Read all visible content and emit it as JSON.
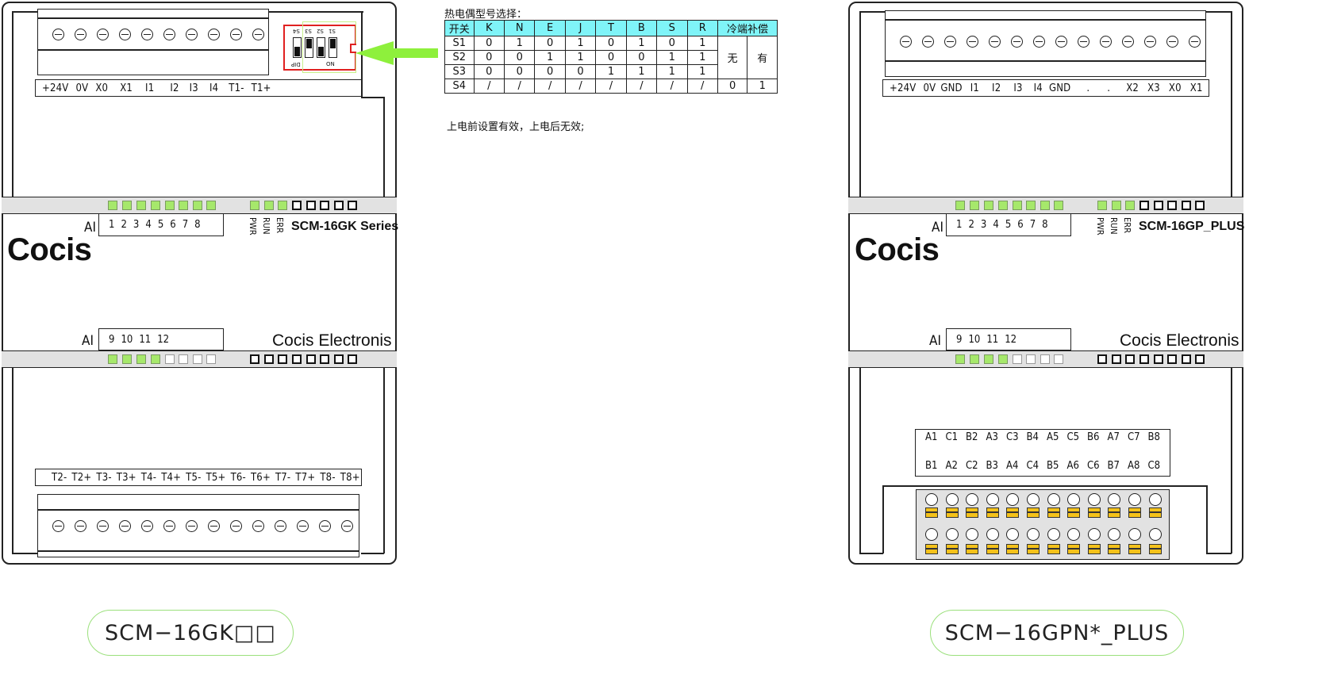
{
  "left_module": {
    "top_terminals": [
      "+24V",
      "0V",
      "X0",
      "X1",
      "I1",
      "I2",
      "I3",
      "I4",
      "T1-",
      "T1+"
    ],
    "dip_labels": [
      "S4",
      "S3",
      "S2",
      "S1"
    ],
    "dip_text_dip": "DIP",
    "dip_text_on": "ON",
    "ai_label_1": "AI",
    "ai_numbers_1": [
      "1",
      "2",
      "3",
      "4",
      "5",
      "6",
      "7",
      "8"
    ],
    "status_labels": [
      "PWR",
      "RUN",
      "ERR"
    ],
    "series_name": "SCM-16GK Series",
    "brand": "Cocis",
    "ai_label_2": "AI",
    "ai_numbers_2": [
      "9",
      "10",
      "11",
      "12"
    ],
    "company": "Cocis Electronis",
    "bottom_terminals": [
      "T2-",
      "T2+",
      "T3-",
      "T3+",
      "T4-",
      "T4+",
      "T5-",
      "T5+",
      "T6-",
      "T6+",
      "T7-",
      "T7+",
      "T8-",
      "T8+"
    ],
    "model_label": "SCM−16GK□□"
  },
  "right_module": {
    "top_terminals": [
      "+24V",
      "0V",
      "GND",
      "I1",
      "I2",
      "I3",
      "I4",
      "GND",
      ".",
      ".",
      "X2",
      "X3",
      "X0",
      "X1"
    ],
    "ai_label_1": "AI",
    "ai_numbers_1": [
      "1",
      "2",
      "3",
      "4",
      "5",
      "6",
      "7",
      "8"
    ],
    "status_labels": [
      "PWR",
      "RUN",
      "ERR"
    ],
    "series_name": "SCM-16GP_PLUS",
    "brand": "Cocis",
    "ai_label_2": "AI",
    "ai_numbers_2": [
      "9",
      "10",
      "11",
      "12"
    ],
    "company": "Cocis Electronis",
    "connector_row1": [
      "A1",
      "C1",
      "B2",
      "A3",
      "C3",
      "B4",
      "A5",
      "C5",
      "B6",
      "A7",
      "C7",
      "B8"
    ],
    "connector_row2": [
      "B1",
      "A2",
      "C2",
      "B3",
      "A4",
      "C4",
      "B5",
      "A6",
      "C6",
      "B7",
      "A8",
      "C8"
    ],
    "model_label": "SCM−16GPN*_PLUS"
  },
  "thermocouple_table": {
    "title": "热电偶型号选择：",
    "header": [
      "开关",
      "K",
      "N",
      "E",
      "J",
      "T",
      "B",
      "S",
      "R"
    ],
    "cold_comp_header": "冷端补偿",
    "rows": [
      {
        "sw": "S1",
        "vals": [
          "0",
          "1",
          "0",
          "1",
          "0",
          "1",
          "0",
          "1"
        ]
      },
      {
        "sw": "S2",
        "vals": [
          "0",
          "0",
          "1",
          "1",
          "0",
          "0",
          "1",
          "1"
        ]
      },
      {
        "sw": "S3",
        "vals": [
          "0",
          "0",
          "0",
          "0",
          "1",
          "1",
          "1",
          "1"
        ]
      },
      {
        "sw": "S4",
        "vals": [
          "/",
          "/",
          "/",
          "/",
          "/",
          "/",
          "/",
          "/"
        ]
      }
    ],
    "comp_none": "无",
    "comp_yes": "有",
    "comp_s4_none": "0",
    "comp_s4_yes": "1",
    "note": "上电前设置有效，上电后无效;"
  },
  "colors": {
    "led_on": "#a6e86b",
    "header_cyan": "#7ff4f8",
    "arrow_green": "#8ef03c",
    "terminal_yellow": "#f4c21a",
    "dip_red": "#e02020"
  }
}
